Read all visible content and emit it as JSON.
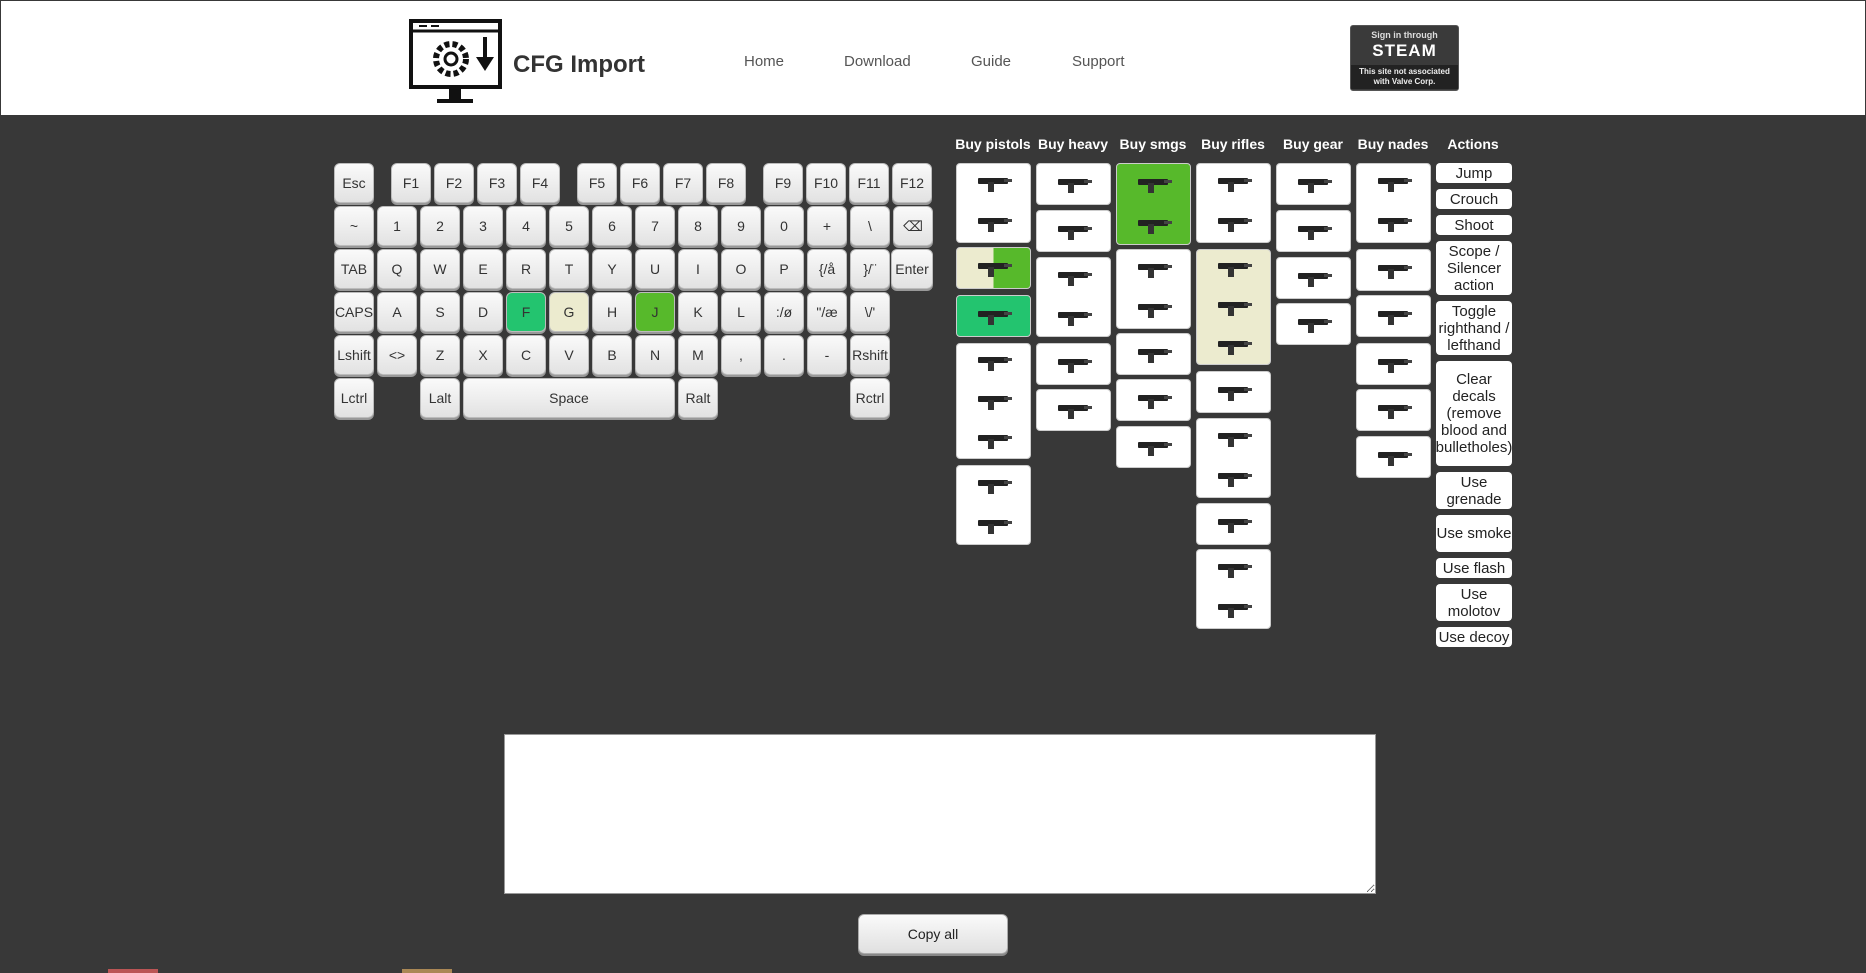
{
  "header": {
    "logo_text": "CFG Import",
    "nav": [
      "Home",
      "Download",
      "Guide",
      "Support"
    ],
    "steam": {
      "line1": "Sign in through",
      "line2": "STEAM",
      "line3": "This site not associated",
      "line4": "with Valve Corp."
    }
  },
  "keyboard": {
    "rows": [
      [
        "Esc",
        "F1",
        "F2",
        "F3",
        "F4",
        "F5",
        "F6",
        "F7",
        "F8",
        "F9",
        "F10",
        "F11",
        "F12"
      ],
      [
        "~",
        "1",
        "2",
        "3",
        "4",
        "5",
        "6",
        "7",
        "8",
        "9",
        "0",
        "+",
        "\\",
        "⌫"
      ],
      [
        "TAB",
        "Q",
        "W",
        "E",
        "R",
        "T",
        "Y",
        "U",
        "I",
        "O",
        "P",
        "{/å",
        "}/¨",
        "Enter"
      ],
      [
        "CAPS",
        "A",
        "S",
        "D",
        "F",
        "G",
        "H",
        "J",
        "K",
        "L",
        ":/ø",
        "\"/æ",
        "\\/'"
      ],
      [
        "Lshift",
        "<>",
        "Z",
        "X",
        "C",
        "V",
        "B",
        "N",
        "M",
        ",",
        ".",
        "-",
        "Rshift"
      ],
      [
        "Lctrl",
        "Lalt",
        "Space",
        "Ralt",
        "Rctrl"
      ]
    ],
    "highlighted": {
      "F": "#23c46f",
      "G": "#ecebcf",
      "J": "#57b92b"
    }
  },
  "columns": [
    "Buy pistols",
    "Buy heavy",
    "Buy smgs",
    "Buy rifles",
    "Buy gear",
    "Buy nades",
    "Actions"
  ],
  "actions": [
    "Jump",
    "Crouch",
    "Shoot",
    "Scope / Silencer action",
    "Toggle righthand / lefthand",
    "Clear decals (remove blood and bulletholes)",
    "Use grenade",
    "Use smoke",
    "Use flash",
    "Use molotov",
    "Use decoy"
  ],
  "copy_button": "Copy all",
  "output_text": "",
  "colors": {
    "background": "#383838",
    "teal": "#23c46f",
    "lime": "#57b92b",
    "pale": "#ecebcf"
  }
}
